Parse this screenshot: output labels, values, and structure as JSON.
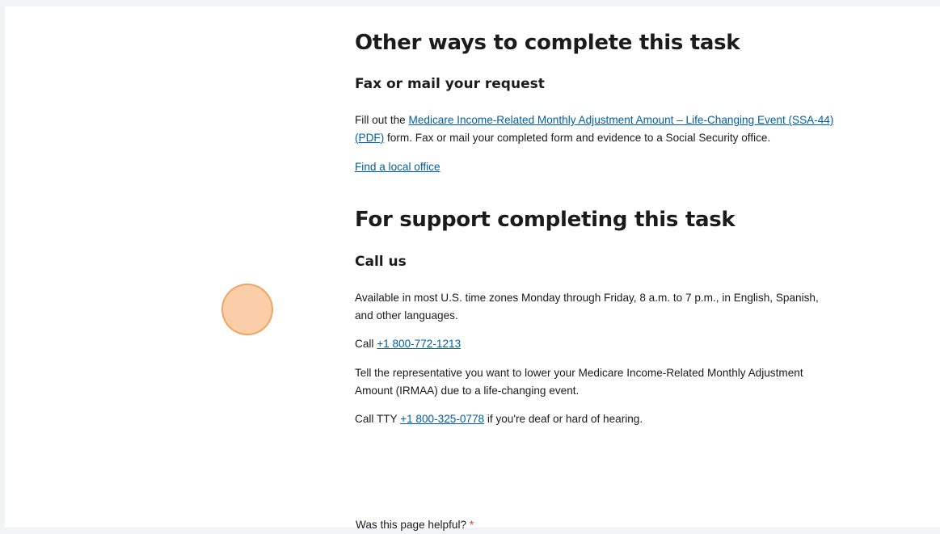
{
  "other_ways": {
    "heading": "Other ways to complete this task",
    "subheading": "Fax or mail your request",
    "fill_prefix": "Fill out the ",
    "form_link": "Medicare Income-Related Monthly Adjustment Amount – Life-Changing Event (SSA-44) (PDF)",
    "fill_suffix": " form. Fax or mail your completed form and evidence to a Social Security office.",
    "find_office_link": "Find a local office"
  },
  "support": {
    "heading": "For support completing this task",
    "subheading": "Call us",
    "availability": "Available in most U.S. time zones Monday through Friday, 8 a.m. to 7 p.m., in English, Spanish, and other languages.",
    "call_prefix": "Call ",
    "phone": "+1 800-772-1213",
    "instructions": "Tell the representative you want to lower your Medicare Income-Related Monthly Adjustment Amount (IRMAA) due to a life-changing event.",
    "tty_prefix": "Call TTY ",
    "tty_phone": "+1 800-325-0778",
    "tty_suffix": " if you're deaf or hard of hearing."
  },
  "feedback": {
    "question": "Was this page helpful?",
    "required_mark": "*"
  }
}
